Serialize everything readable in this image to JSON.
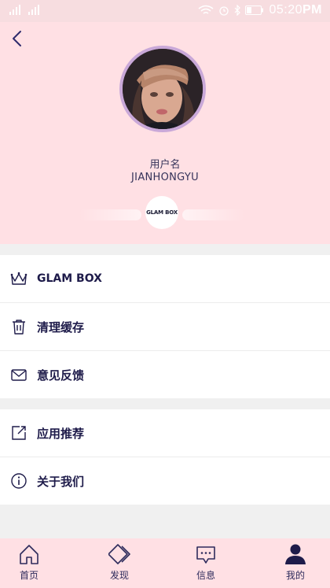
{
  "status_bar": {
    "time": "05:20",
    "ampm": "PM"
  },
  "profile": {
    "label": "用户名",
    "username": "JIANHONGYU",
    "badge_text": "GLAM BOX"
  },
  "menu_group_1": [
    {
      "label": "GLAM BOX",
      "icon": "crown-icon"
    },
    {
      "label": "清理缓存",
      "icon": "trash-icon"
    },
    {
      "label": "意见反馈",
      "icon": "mail-icon"
    }
  ],
  "menu_group_2": [
    {
      "label": "应用推荐",
      "icon": "share-icon"
    },
    {
      "label": "关于我们",
      "icon": "info-icon"
    }
  ],
  "tabs": [
    {
      "label": "首页",
      "icon": "home-icon"
    },
    {
      "label": "发现",
      "icon": "discover-icon"
    },
    {
      "label": "信息",
      "icon": "message-icon"
    },
    {
      "label": "我的",
      "icon": "person-icon",
      "active": true
    }
  ],
  "colors": {
    "accent": "#1e1b4a",
    "header_bg": "#ffe0e4",
    "status_bg": "#f7dde0"
  }
}
